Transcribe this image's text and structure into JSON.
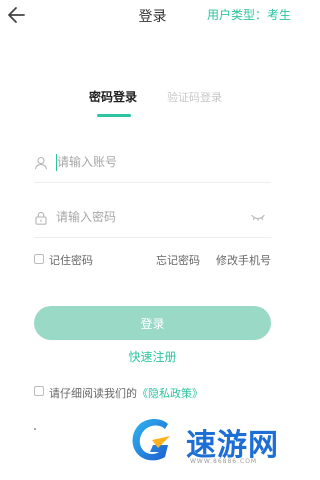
{
  "header": {
    "back_icon": "arrow-left-icon",
    "title": "登录",
    "user_type": "用户类型：考生"
  },
  "tabs": {
    "password_login": "密码登录",
    "code_login": "验证码登录",
    "active": "password_login"
  },
  "form": {
    "account": {
      "icon": "user-icon",
      "placeholder": "请输入账号",
      "value": ""
    },
    "password": {
      "icon": "lock-icon",
      "placeholder": "请输入密码",
      "value": "",
      "toggle_icon": "eye-closed-icon"
    },
    "remember_password": "记住密码",
    "remember_checked": false,
    "forgot_password": "忘记密码",
    "change_phone": "修改手机号",
    "login_button": "登录",
    "register_link": "快速注册",
    "agreement": {
      "checked": false,
      "prefix": "请仔细阅读我们的",
      "policy": "《隐私政策》"
    }
  },
  "watermark": {
    "text": "速游网",
    "url": "WWW.86886.COM"
  },
  "colors": {
    "accent": "#2ec4a1",
    "button_disabled": "#9ad9c6",
    "watermark_blue": "#1d6fd6"
  }
}
